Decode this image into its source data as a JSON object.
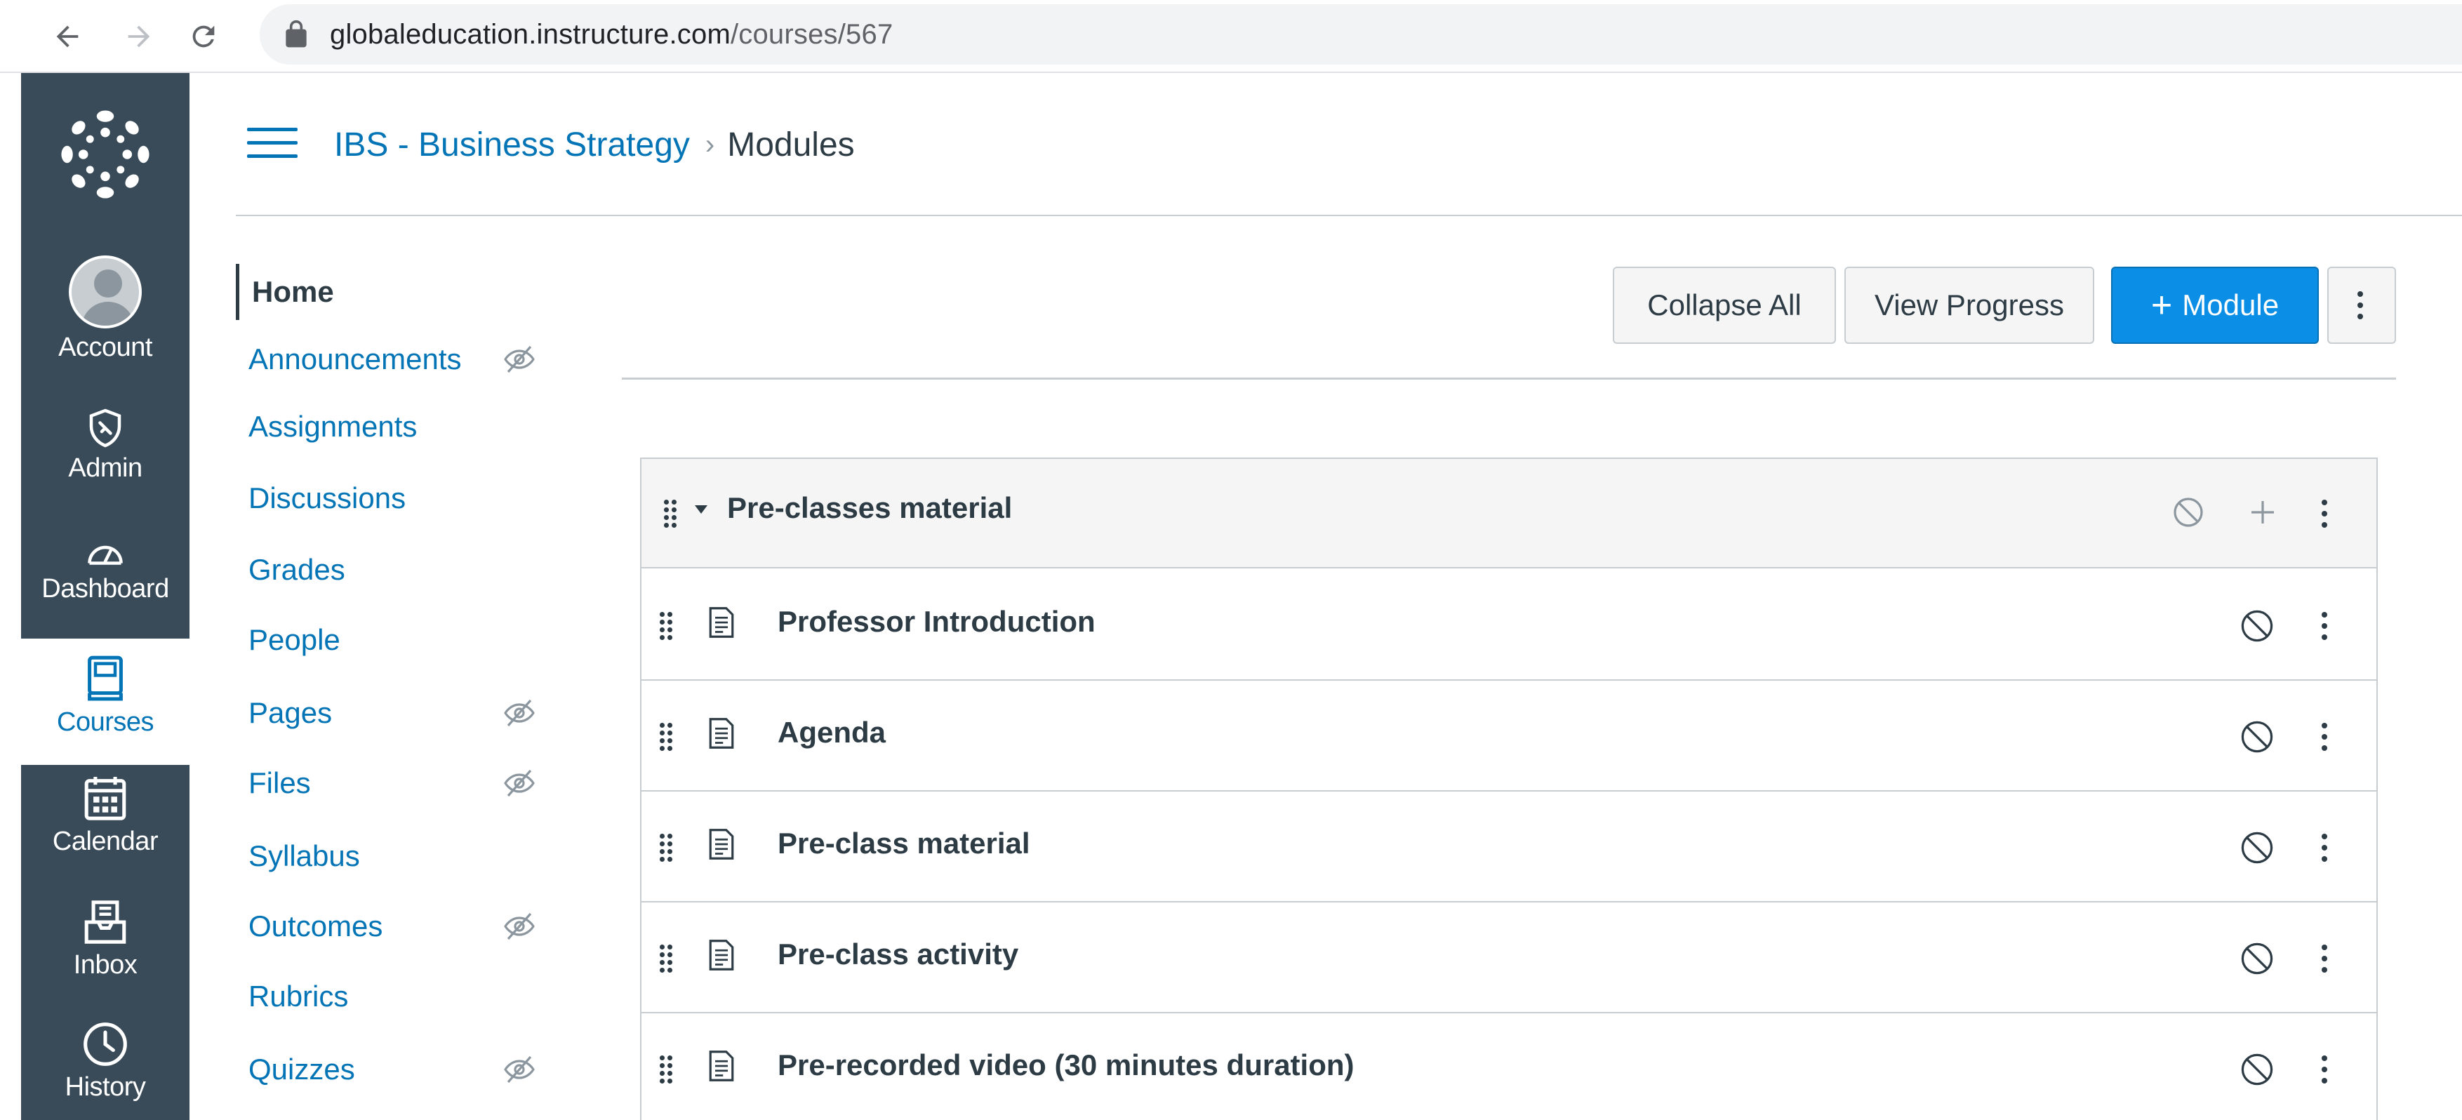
{
  "browser": {
    "url_host": "globaleducation.instructure.com",
    "url_path": "/courses/567"
  },
  "global_nav": {
    "items": [
      {
        "label": "Account",
        "icon": "user-avatar-icon"
      },
      {
        "label": "Admin",
        "icon": "admin-shield-icon"
      },
      {
        "label": "Dashboard",
        "icon": "dashboard-gauge-icon"
      },
      {
        "label": "Courses",
        "icon": "book-icon"
      },
      {
        "label": "Calendar",
        "icon": "calendar-icon"
      },
      {
        "label": "Inbox",
        "icon": "inbox-icon"
      },
      {
        "label": "History",
        "icon": "clock-icon"
      }
    ],
    "active": "Courses",
    "accent": "#0374b5",
    "background": "#394b58"
  },
  "breadcrumb": {
    "course": "IBS - Business Strategy",
    "current": "Modules"
  },
  "course_nav": {
    "items": [
      {
        "label": "Home",
        "hidden": false
      },
      {
        "label": "Announcements",
        "hidden": true
      },
      {
        "label": "Assignments",
        "hidden": false
      },
      {
        "label": "Discussions",
        "hidden": false
      },
      {
        "label": "Grades",
        "hidden": false
      },
      {
        "label": "People",
        "hidden": false
      },
      {
        "label": "Pages",
        "hidden": true
      },
      {
        "label": "Files",
        "hidden": true
      },
      {
        "label": "Syllabus",
        "hidden": false
      },
      {
        "label": "Outcomes",
        "hidden": true
      },
      {
        "label": "Rubrics",
        "hidden": false
      },
      {
        "label": "Quizzes",
        "hidden": true
      }
    ],
    "active": "Home"
  },
  "toolbar": {
    "collapse_all": "Collapse All",
    "view_progress": "View Progress",
    "add_module": "Module",
    "add_module_plus": "+",
    "primary_color": "#0b8fe6"
  },
  "module": {
    "title": "Pre-classes material",
    "items": [
      {
        "title": "Professor Introduction"
      },
      {
        "title": "Agenda"
      },
      {
        "title": "Pre-class material"
      },
      {
        "title": "Pre-class activity"
      },
      {
        "title": "Pre-recorded video (30 minutes duration)"
      }
    ]
  }
}
